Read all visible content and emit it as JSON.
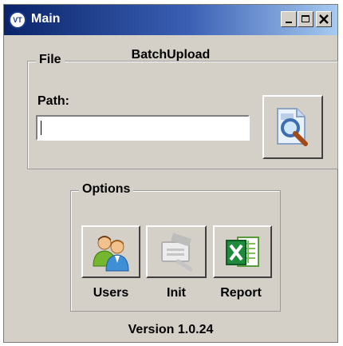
{
  "window": {
    "title": "Main",
    "app_icon_text": "VT"
  },
  "app": {
    "title": "BatchUpload",
    "version": "Version 1.0.24"
  },
  "file_group": {
    "legend": "File",
    "path_label": "Path:",
    "path_value": ""
  },
  "options_group": {
    "legend": "Options",
    "buttons": [
      {
        "label": "Users",
        "icon": "users-icon",
        "enabled": true
      },
      {
        "label": "Init",
        "icon": "init-icon",
        "enabled": false
      },
      {
        "label": "Report",
        "icon": "excel-report-icon",
        "enabled": true
      }
    ]
  },
  "colors": {
    "window_bg": "#d4d0c8",
    "title_gradient_start": "#0a246a",
    "title_gradient_end": "#a6caf0"
  }
}
